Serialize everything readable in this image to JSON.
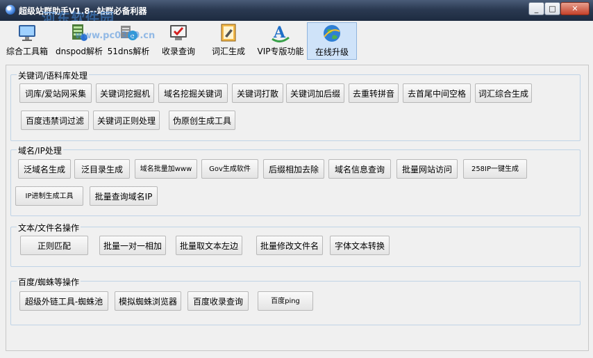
{
  "window": {
    "title": "超级站群助手V1.8--站群必备利器",
    "controls": [
      "_",
      "□",
      "✕"
    ]
  },
  "watermark": {
    "text": "河东软件园",
    "url": "www.pc0359.cn"
  },
  "toolbar": [
    {
      "label": "综合工具箱",
      "icon": "monitor-icon"
    },
    {
      "label": "dnspod解析",
      "icon": "server-icon"
    },
    {
      "label": "51dns解析",
      "icon": "network-icon"
    },
    {
      "label": "收录查询",
      "icon": "check-screen-icon"
    },
    {
      "label": "词汇生成",
      "icon": "notepad-icon"
    },
    {
      "label": "VIP专版功能",
      "icon": "font-icon"
    },
    {
      "label": "在线升级",
      "icon": "globe-icon"
    }
  ],
  "groups": {
    "keywords": {
      "title": "关键词/语料库处理",
      "buttons": [
        "词库/爱站网采集",
        "关键词挖掘机",
        "域名挖掘关键词",
        "关键词打散",
        "关键词加后缀",
        "去重转拼音",
        "去首尾中间空格",
        "词汇综合生成",
        "百度违禁词过滤",
        "关键词正则处理",
        "伪原创生成工具"
      ]
    },
    "domain": {
      "title": "域名/IP处理",
      "buttons": [
        "泛域名生成",
        "泛目录生成",
        "域名批量加www",
        "Gov生成软件",
        "后缀相加去除",
        "域名信息查询",
        "批量网站访问",
        "258IP一键生成",
        "IP进制生成工具",
        "批量查询域名IP"
      ]
    },
    "text": {
      "title": "文本/文件名操作",
      "buttons": [
        "正则匹配",
        "批量一对一相加",
        "批量取文本左边",
        "批量修改文件名",
        "字体文本转换"
      ]
    },
    "baidu": {
      "title": "百度/蜘蛛等操作",
      "buttons": [
        "超级外链工具-蜘蛛池",
        "模拟蜘蛛浏览器",
        "百度收录查询",
        "百度ping"
      ]
    }
  }
}
